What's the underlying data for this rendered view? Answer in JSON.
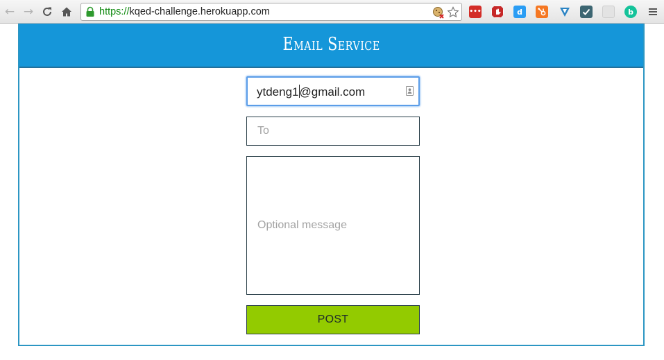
{
  "browser": {
    "url_scheme": "https://",
    "url_host": "kqed-challenge.herokuapp.com"
  },
  "page": {
    "title": "Email Service",
    "from_value_before_caret": "ytdeng1",
    "from_value_after_caret": "@gmail.com",
    "to_placeholder": "To",
    "message_placeholder": "Optional message",
    "post_label": "POST"
  },
  "colors": {
    "header": "#1596d9",
    "post_button": "#93cb00",
    "field_border": "#263b45",
    "focus_border": "#5b9de8"
  },
  "extensions": [
    {
      "name": "lastpass-icon",
      "color": "#d32d27"
    },
    {
      "name": "ublock-icon",
      "color": "#c62828"
    },
    {
      "name": "disconnect-icon",
      "color": "#2a9df4"
    },
    {
      "name": "hubspot-icon",
      "color": "#f57722"
    },
    {
      "name": "vimium-icon",
      "color": "#1d6fa5"
    },
    {
      "name": "checkmark-extension-icon",
      "color": "#3d6672"
    },
    {
      "name": "blank-extension-icon",
      "color": "#cfcfcf"
    },
    {
      "name": "grammarly-icon",
      "color": "#15c39a"
    }
  ]
}
